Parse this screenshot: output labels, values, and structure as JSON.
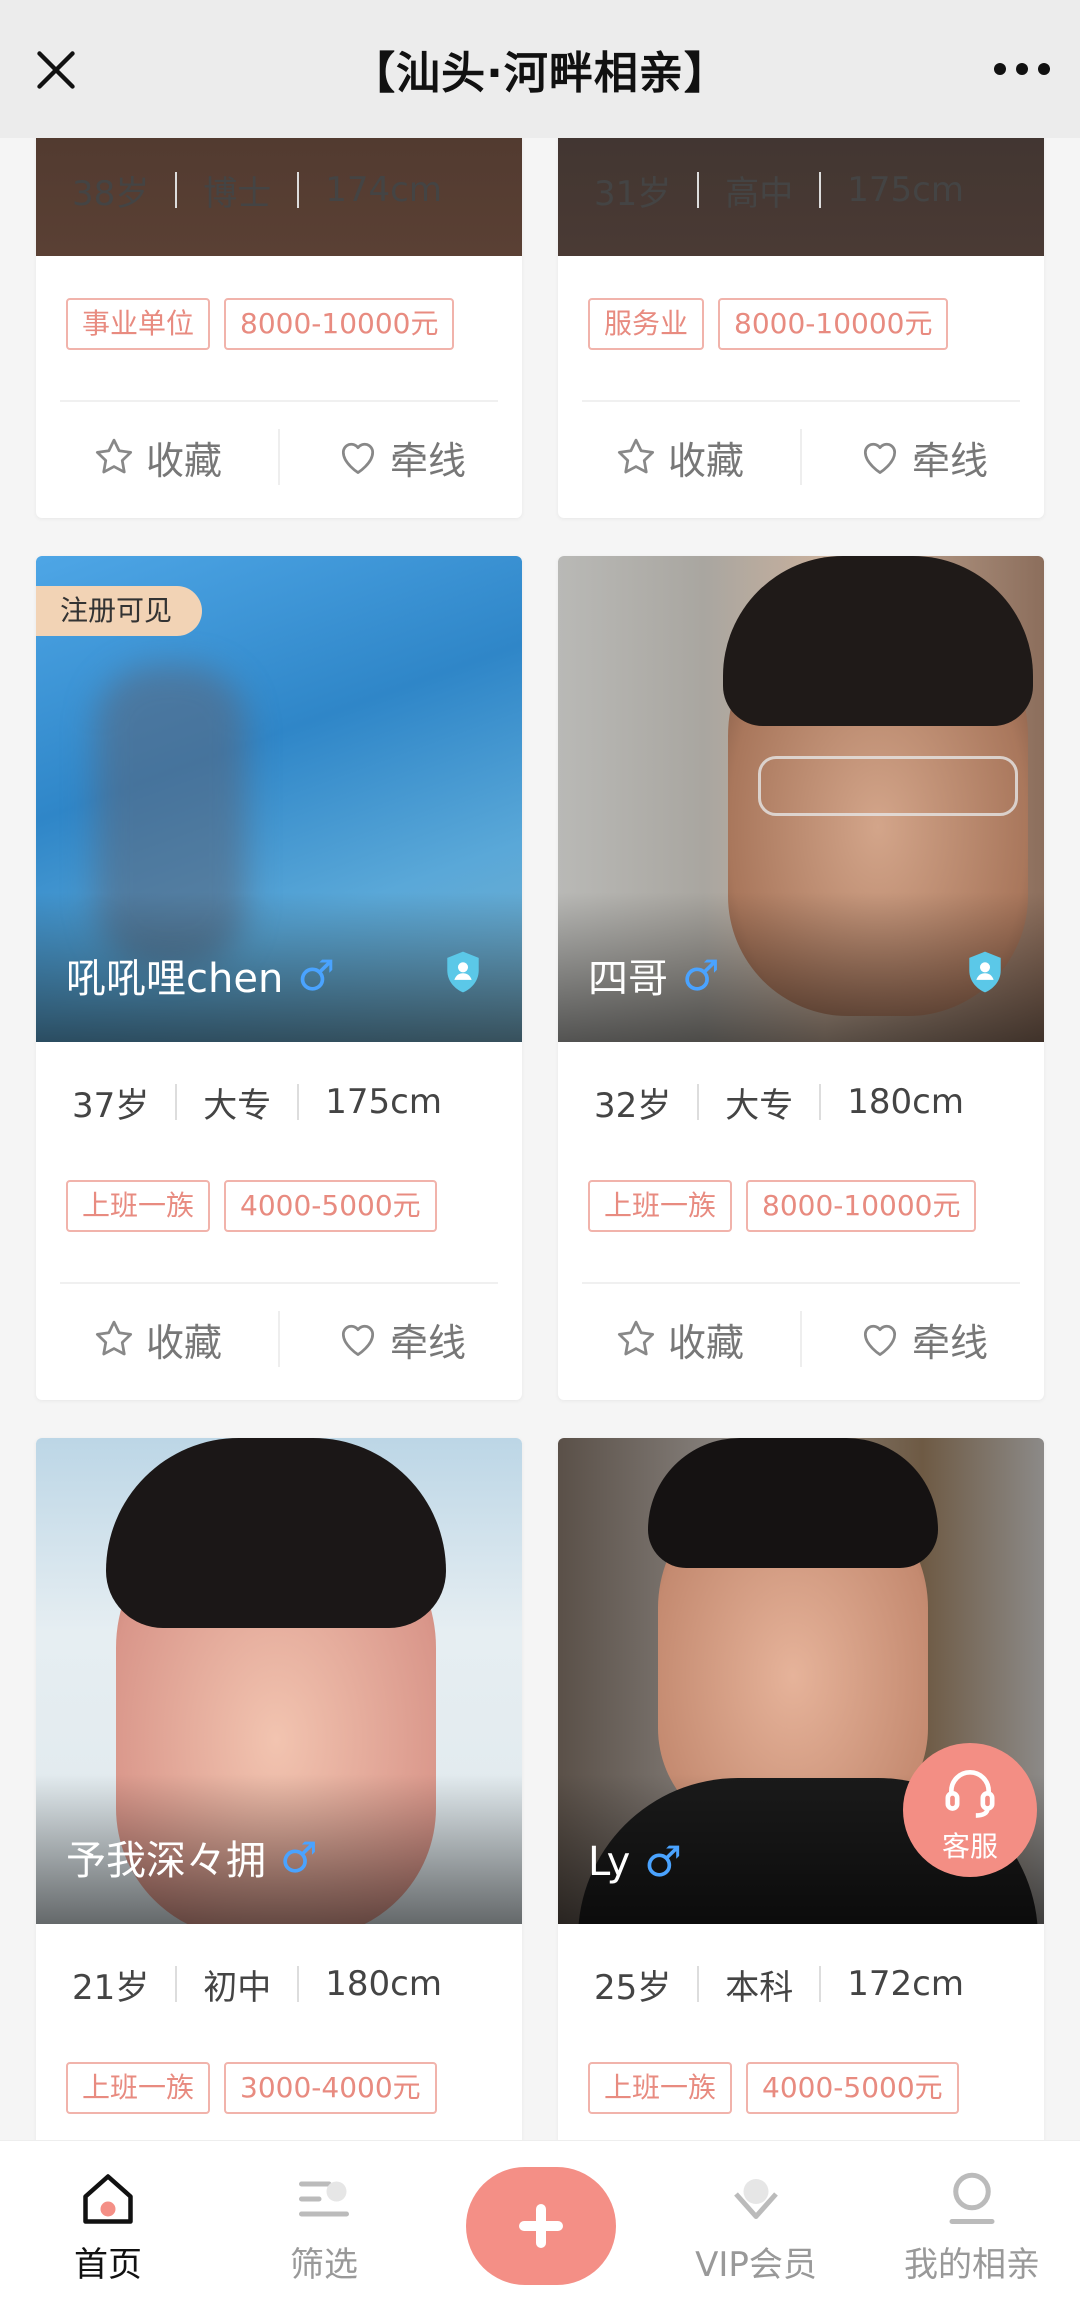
{
  "header": {
    "title": "【汕头·河畔相亲】"
  },
  "cards": [
    {
      "age": "38岁",
      "education": "博士",
      "height": "174cm",
      "tags": [
        "事业单位",
        "8000-10000元"
      ],
      "fav_label": "收藏",
      "match_label": "牵线"
    },
    {
      "age": "31岁",
      "education": "高中",
      "height": "175cm",
      "tags": [
        "服务业",
        "8000-10000元"
      ],
      "fav_label": "收藏",
      "match_label": "牵线"
    },
    {
      "name": "吼吼哩chen",
      "gender": "♂",
      "badge": "注册可见",
      "age": "37岁",
      "education": "大专",
      "height": "175cm",
      "tags": [
        "上班一族",
        "4000-5000元"
      ],
      "fav_label": "收藏",
      "match_label": "牵线"
    },
    {
      "name": "四哥",
      "gender": "♂",
      "age": "32岁",
      "education": "大专",
      "height": "180cm",
      "tags": [
        "上班一族",
        "8000-10000元"
      ],
      "fav_label": "收藏",
      "match_label": "牵线"
    },
    {
      "name": "予我深々拥",
      "gender": "♂",
      "age": "21岁",
      "education": "初中",
      "height": "180cm",
      "tags": [
        "上班一族",
        "3000-4000元"
      ]
    },
    {
      "name": "Ly",
      "gender": "♂",
      "age": "25岁",
      "education": "本科",
      "height": "172cm",
      "tags": [
        "上班一族",
        "4000-5000元"
      ]
    }
  ],
  "service": {
    "label": "客服"
  },
  "nav": {
    "items": [
      {
        "label": "首页",
        "icon": "home-icon"
      },
      {
        "label": "筛选",
        "icon": "filter-icon"
      },
      {
        "label": "VIP会员",
        "icon": "vip-icon"
      },
      {
        "label": "我的相亲",
        "icon": "profile-icon"
      }
    ]
  },
  "colors": {
    "accent": "#f48f86",
    "tag_border": "#f1b3ab",
    "tag_text": "#e88b80",
    "gender": "#4aa3ff",
    "verified": "#5bc8e8"
  }
}
